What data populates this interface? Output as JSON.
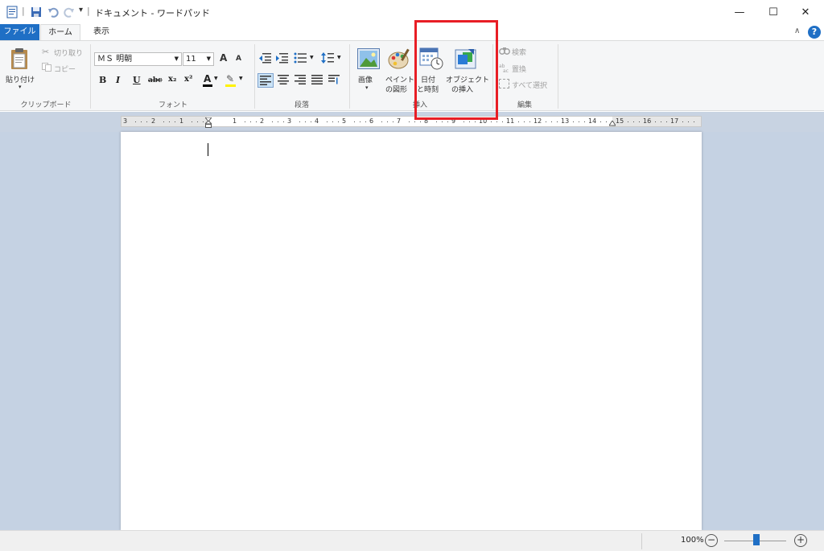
{
  "window": {
    "title": "ドキュメント - ワードパッド",
    "controls": {
      "minimize": "—",
      "maximize": "☐",
      "close": "✕"
    }
  },
  "quick_access": {
    "separator": "|",
    "customize": "▾"
  },
  "tabs": [
    {
      "label": "ファイル",
      "selected": false
    },
    {
      "label": "ホーム",
      "selected": true
    },
    {
      "label": "表示",
      "selected": false
    }
  ],
  "ribbon": {
    "collapse_icon": "∧",
    "help_icon": "?",
    "clipboard": {
      "label": "クリップボード",
      "paste": "貼り付け",
      "paste_arrow": "▾",
      "cut": "切り取り",
      "copy": "コピー"
    },
    "font": {
      "label": "フォント",
      "family": "ＭＳ 明朝",
      "size": "11",
      "grow": "A",
      "shrink": "A",
      "bold": "B",
      "italic": "I",
      "underline": "U",
      "strike": "abc",
      "subscript": "x₂",
      "superscript": "x²",
      "color": "A",
      "highlight": "✎"
    },
    "paragraph": {
      "label": "段落"
    },
    "insert": {
      "label": "挿入",
      "picture_l1": "画像",
      "picture_arrow": "▾",
      "paint_l1": "ペイント",
      "paint_l2": "の図形",
      "datetime_l1": "日付",
      "datetime_l2": "と時刻",
      "object_l1": "オブジェクト",
      "object_l2": "の挿入"
    },
    "editing": {
      "label": "編集",
      "find": "検索",
      "replace": "置換",
      "select_all": "すべて選択"
    }
  },
  "ruler": {
    "labels": [
      "3",
      "2",
      "1",
      "1",
      "2",
      "3",
      "4",
      "5",
      "6",
      "7",
      "8",
      "9",
      "10",
      "11",
      "12",
      "13",
      "14",
      "15",
      "16",
      "17"
    ]
  },
  "statusbar": {
    "zoom": "100%",
    "zoom_fraction": 0.5,
    "zoom_out": "−",
    "zoom_in": "+"
  },
  "colors": {
    "accent": "#1f6fc5",
    "highlight_box": "#e81e25",
    "workspace": "#c5d2e3"
  }
}
